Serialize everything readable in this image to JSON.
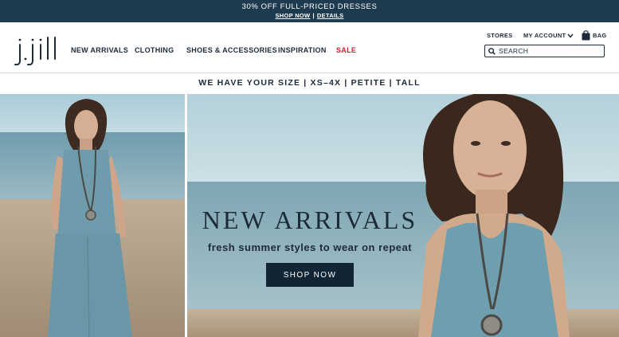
{
  "promo": {
    "title": "30% OFF FULL-PRICED DRESSES",
    "shop_now": "SHOP NOW",
    "separator": "|",
    "details": "DETAILS"
  },
  "header": {
    "logo_text": "j.jill",
    "nav": [
      {
        "label": "NEW ARRIVALS"
      },
      {
        "label": "CLOTHING"
      },
      {
        "label": "SHOES & ACCESSORIES"
      },
      {
        "label": "INSPIRATION"
      },
      {
        "label": "SALE",
        "color": "#d21f2f"
      }
    ],
    "stores": "STORES",
    "my_account": "MY ACCOUNT",
    "bag": "BAG",
    "search_placeholder": "SEARCH"
  },
  "size_banner": "WE HAVE YOUR SIZE | XS–4X | PETITE | TALL",
  "hero": {
    "heading": "NEW ARRIVALS",
    "subheading": "fresh summer styles to wear on repeat",
    "cta": "SHOP NOW"
  },
  "colors": {
    "promo_bg": "#1d3a4e",
    "text": "#1c2a3a",
    "sale": "#d21f2f",
    "cta_bg": "#122535"
  },
  "icons": [
    "search-icon",
    "chevron-down-icon",
    "shopping-bag-icon"
  ]
}
